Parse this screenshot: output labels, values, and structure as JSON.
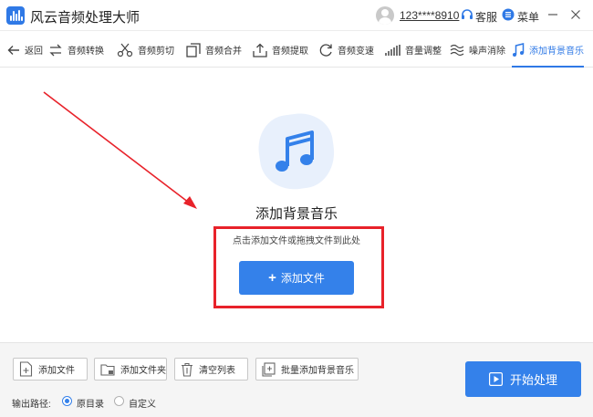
{
  "app": {
    "title": "风云音频处理大师",
    "username": "123****8910",
    "support_label": "客服",
    "menu_label": "菜单",
    "accent_color": "#3481ea"
  },
  "toolbar": {
    "back_label": "返回",
    "items": [
      {
        "label": "音频转换",
        "icon": "convert-icon"
      },
      {
        "label": "音频剪切",
        "icon": "scissors-icon"
      },
      {
        "label": "音频合并",
        "icon": "merge-icon"
      },
      {
        "label": "音频提取",
        "icon": "extract-icon"
      },
      {
        "label": "音频变速",
        "icon": "speed-icon"
      },
      {
        "label": "音量调整",
        "icon": "volume-bars-icon"
      },
      {
        "label": "噪声消除",
        "icon": "noise-icon"
      },
      {
        "label": "添加背景音乐",
        "icon": "music-note-icon",
        "active": true
      }
    ]
  },
  "main": {
    "title": "添加背景音乐",
    "hint": "点击添加文件或拖拽文件到此处",
    "add_file_label": "添加文件",
    "highlight_color": "#e8222a"
  },
  "bottom": {
    "buttons": [
      {
        "label": "添加文件",
        "icon": "add-file-icon"
      },
      {
        "label": "添加文件夹",
        "icon": "add-folder-icon"
      },
      {
        "label": "清空列表",
        "icon": "trash-icon"
      },
      {
        "label": "批量添加背景音乐",
        "icon": "batch-icon"
      }
    ],
    "start_label": "开始处理",
    "output_label": "输出路径:",
    "output_options": [
      {
        "label": "原目录",
        "selected": true
      },
      {
        "label": "自定义",
        "selected": false
      }
    ]
  }
}
